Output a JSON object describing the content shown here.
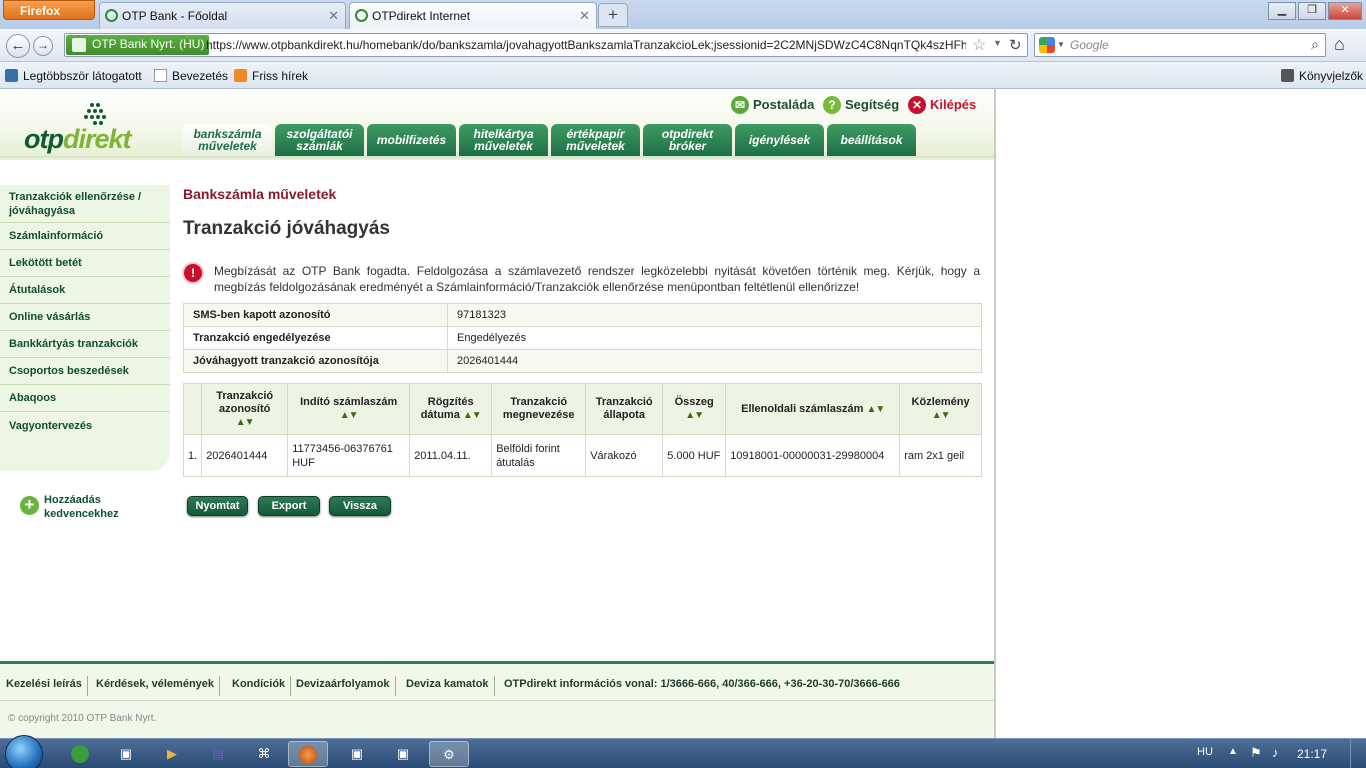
{
  "browser": {
    "app_button": "Firefox",
    "tabs": [
      {
        "title": "OTP Bank - Főoldal"
      },
      {
        "title": "OTPdirekt Internet"
      }
    ],
    "identity": "OTP Bank Nyrt. (HU)",
    "url": "https://www.otpbankdirekt.hu/homebank/do/bankszamla/jovahagyottBankszamlaTranzakcioLek;jsessionid=2C2MNjSDWzC4C8NqnTQk4szHFhV",
    "search_placeholder": "Google",
    "bookmarks": [
      "Legtöbbször látogatott",
      "Bevezetés",
      "Friss hírek"
    ],
    "bookmarks_menu": "Könyvjelzők"
  },
  "header": {
    "logo_otp": "otp",
    "logo_direkt": "direkt",
    "links": [
      "Postaláda",
      "Segítség",
      "Kilépés"
    ],
    "menu": [
      "bankszámla\nműveletek",
      "szolgáltatói\nszámlák",
      "mobilfizetés",
      "hitelkártya\nműveletek",
      "értékpapír\nműveletek",
      "otpdirekt\nbróker",
      "igénylések",
      "beállítások"
    ]
  },
  "sidebar": {
    "items": [
      "Tranzakciók ellenőrzése / jóváhagyása",
      "Számlainformáció",
      "Lekötött betét",
      "Átutalások",
      "Online vásárlás",
      "Bankkártyás tranzakciók",
      "Csoportos beszedések",
      "Abaqoos",
      "Vagyontervezés"
    ],
    "favorite": "Hozzáadás kedvencekhez"
  },
  "main": {
    "section_title": "Bankszámla műveletek",
    "page_title": "Tranzakció jóváhagyás",
    "notice": "Megbízását az OTP Bank fogadta. Feldolgozása a számlavezető rendszer legközelebbi nyitását követően történik meg. Kérjük, hogy a megbízás feldolgozásának eredményét a Számlainformáció/Tranzakciók ellenőrzése menüpontban feltétlenül ellenőrizze!",
    "info": [
      {
        "label": "SMS-ben kapott azonosító",
        "value": "97181323"
      },
      {
        "label": "Tranzakció engedélyezése",
        "value": "Engedélyezés"
      },
      {
        "label": "Jóváhagyott tranzakció azonosítója",
        "value": "2026401444"
      }
    ],
    "columns": [
      "",
      "Tranzakció azonosító",
      "Indító számlaszám",
      "Rögzítés dátuma",
      "Tranzakció megnevezése",
      "Tranzakció állapota",
      "Összeg",
      "Ellenoldali számlaszám",
      "Közlemény"
    ],
    "rows": [
      [
        "1.",
        "2026401444",
        "11773456-06376761 HUF",
        "2011.04.11.",
        "Belföldi forint átutalás",
        "Várakozó",
        "5.000 HUF",
        "10918001-00000031-29980004",
        "ram 2x1 geil"
      ]
    ],
    "buttons": [
      "Nyomtat",
      "Export",
      "Vissza"
    ]
  },
  "footer": {
    "links": [
      "Kezelési leírás",
      "Kérdések, vélemények",
      "Kondíciók",
      "Devizaárfolyamok",
      "Deviza kamatok",
      "OTPdirekt információs vonal: 1/3666-666, 40/366-666, +36-20-30-70/3666-666"
    ],
    "copyright": "© copyright 2010 OTP Bank Nyrt."
  },
  "taskbar": {
    "lang": "HU",
    "clock": "21:17"
  },
  "colors": {
    "brand_green": "#1e7046",
    "accent_red": "#8a1a33",
    "light_green_bg": "#edf5e3"
  }
}
